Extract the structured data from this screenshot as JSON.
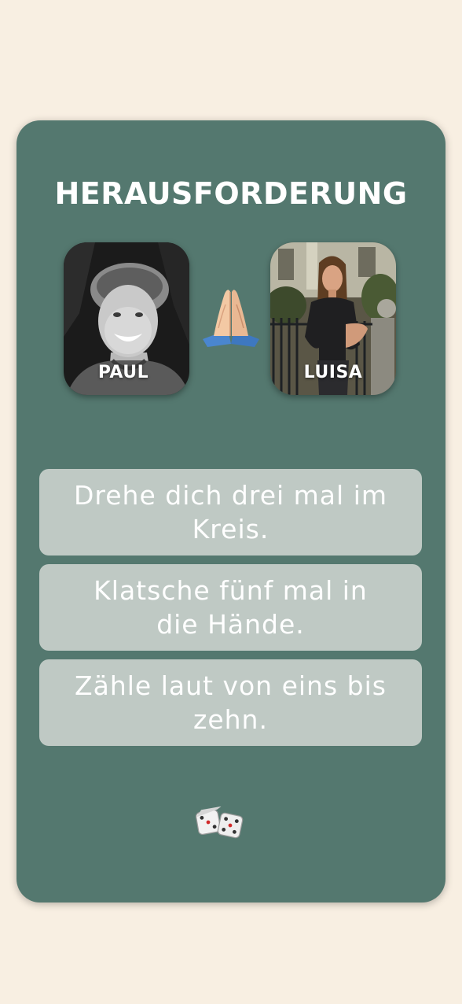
{
  "challenge_screen": {
    "title": "HERAUSFORDERUNG",
    "players": [
      {
        "name": "PAUL",
        "photo": "person-photo-black-and-white"
      },
      {
        "name": "LUISA",
        "photo": "person-photo-color"
      }
    ],
    "versus_icon": "folded-hands-icon",
    "challenges": [
      "Drehe dich drei mal im Kreis.",
      "Klatsche fünf mal in die Hände.",
      "Zähle laut von eins bis zehn."
    ],
    "dice_icon": "dice-icon"
  },
  "colors": {
    "background": "#f8efe2",
    "card": "#54786f",
    "challenge_box": "#bfc9c4",
    "text": "#ffffff"
  }
}
